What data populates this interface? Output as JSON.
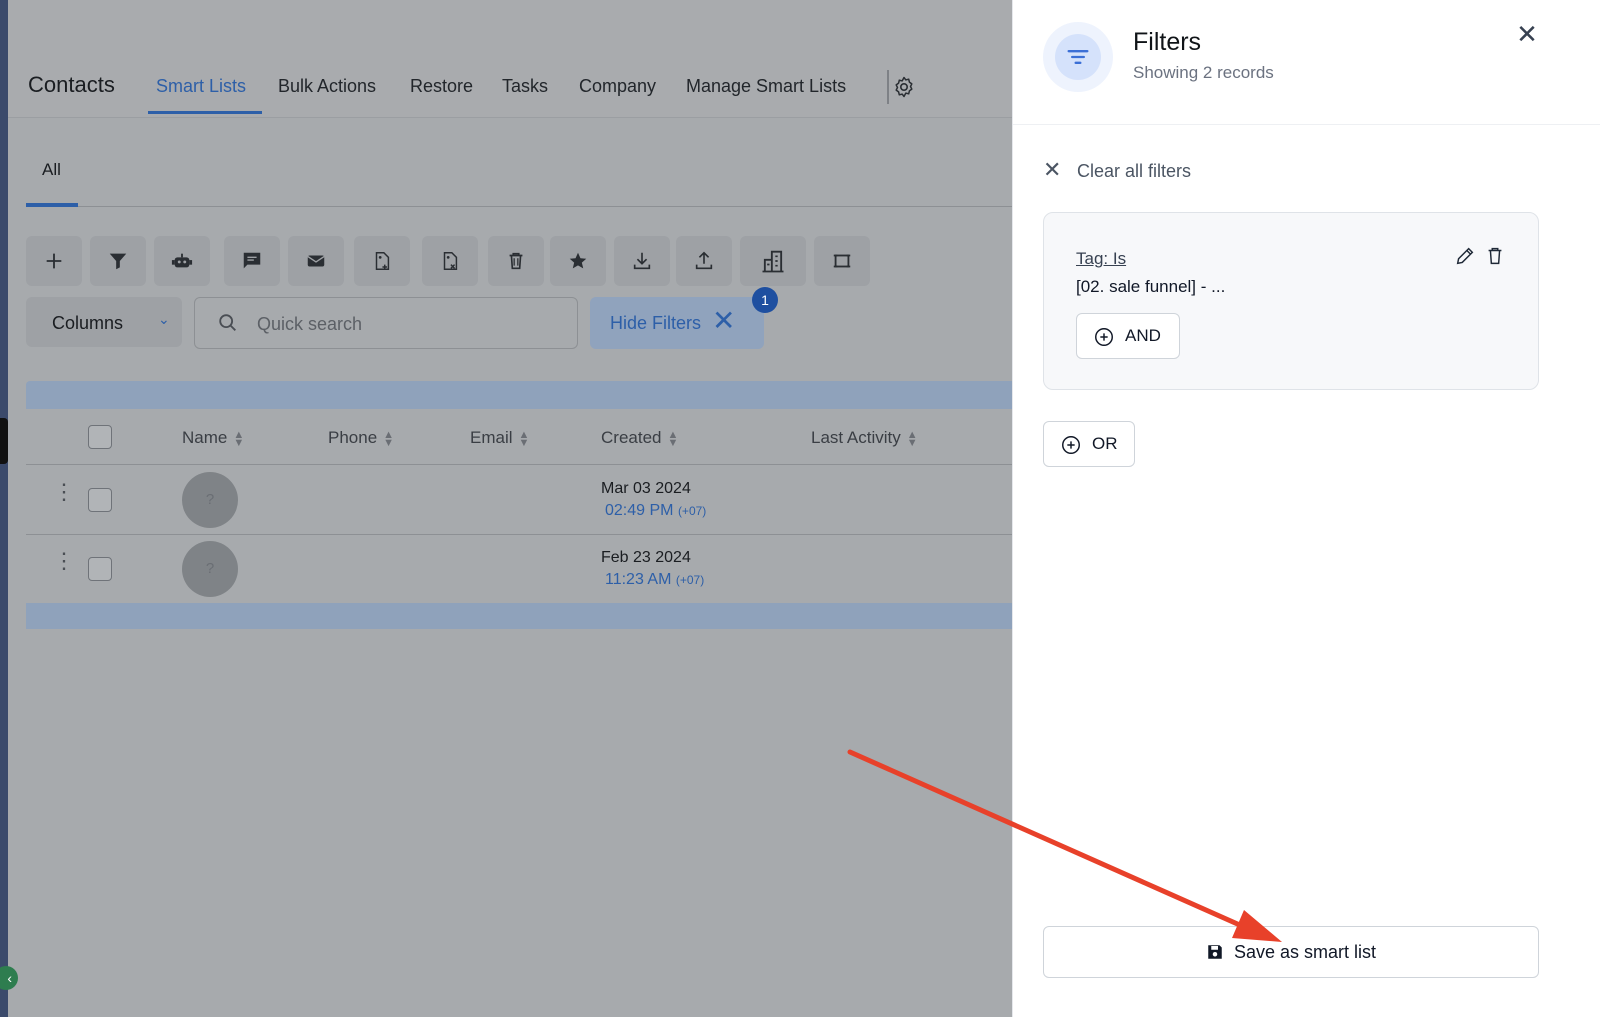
{
  "header": {
    "title": "Contacts",
    "nav": [
      {
        "label": "Smart Lists",
        "active": true
      },
      {
        "label": "Bulk Actions"
      },
      {
        "label": "Restore"
      },
      {
        "label": "Tasks"
      },
      {
        "label": "Company"
      },
      {
        "label": "Manage Smart Lists"
      }
    ],
    "settings_icon": "gear-icon"
  },
  "subtabs": [
    {
      "label": "All",
      "active": true
    }
  ],
  "toolbar": {
    "buttons": [
      "plus-icon",
      "filter-icon",
      "robot-icon",
      "message-icon",
      "mail-icon",
      "tag-add-icon",
      "tag-remove-icon",
      "trash-icon",
      "star-icon",
      "download-icon",
      "upload-icon",
      "building-icon",
      "merge-icon"
    ],
    "columns_label": "Columns",
    "search_placeholder": "Quick search",
    "hide_filters_label": "Hide Filters",
    "filter_count": "1"
  },
  "table": {
    "columns": [
      "Name",
      "Phone",
      "Email",
      "Created",
      "Last Activity"
    ],
    "rows": [
      {
        "avatar": "?",
        "created_date": "Mar 03 2024",
        "created_time": "02:49 PM",
        "tz": "(+07)"
      },
      {
        "avatar": "?",
        "created_date": "Feb 23 2024",
        "created_time": "11:23 AM",
        "tz": "(+07)"
      }
    ]
  },
  "drawer": {
    "title": "Filters",
    "subtitle": "Showing 2 records",
    "clear_all": "Clear all filters",
    "filter": {
      "tag_label": "Tag:  Is",
      "value": "[02. sale funnel] - ..."
    },
    "and_label": "AND",
    "or_label": "OR",
    "save_label": "Save as smart list"
  },
  "colors": {
    "accent": "#2d5fa8",
    "annotation_arrow": "#e8412a"
  }
}
